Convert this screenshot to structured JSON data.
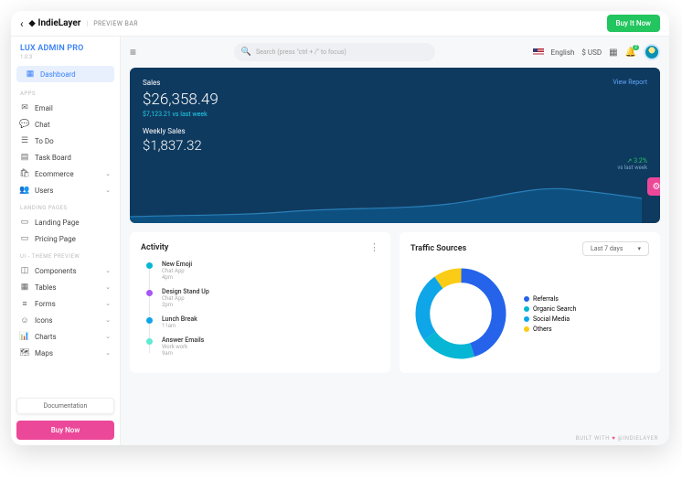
{
  "previewBar": {
    "brand": "IndieLayer",
    "label": "PREVIEW BAR",
    "cta": "Buy It Now"
  },
  "sidebar": {
    "title": "LUX ADMIN PRO",
    "version": "1.0.3",
    "active": "Dashboard",
    "sections": {
      "apps": "APPS",
      "landing": "LANDING PAGES",
      "theme": "UI - THEME PREVIEW"
    },
    "items": {
      "dashboard": "Dashboard",
      "email": "Email",
      "chat": "Chat",
      "todo": "To Do",
      "taskboard": "Task Board",
      "ecommerce": "Ecommerce",
      "users": "Users",
      "landing": "Landing Page",
      "pricing": "Pricing Page",
      "components": "Components",
      "tables": "Tables",
      "forms": "Forms",
      "icons": "Icons",
      "charts": "Charts",
      "maps": "Maps"
    },
    "docs": "Documentation",
    "buynow": "Buy Now"
  },
  "topbar": {
    "search": "Search (press \"ctrl + /\" to focus)",
    "lang": "English",
    "currency": "$ USD",
    "notifications": "2"
  },
  "hero": {
    "title": "Sales",
    "viewReport": "View Report",
    "amount": "$26,358.49",
    "compare": "$7,123.21 vs last week",
    "weeklyTitle": "Weekly Sales",
    "weeklyAmount": "$1,837.32",
    "trendPct": "↗ 3.2%",
    "trendLabel": "vs last week"
  },
  "activity": {
    "title": "Activity",
    "items": [
      {
        "title": "New Emoji",
        "sub": "Chat App",
        "time": "4pm",
        "color": "#06b6d4"
      },
      {
        "title": "Design Stand Up",
        "sub": "Chat App",
        "time": "2pm",
        "color": "#a855f7"
      },
      {
        "title": "Lunch Break",
        "sub": "",
        "time": "11am",
        "color": "#0ea5e9"
      },
      {
        "title": "Answer Emails",
        "sub": "Work work",
        "time": "9am",
        "color": "#5eead4"
      }
    ]
  },
  "traffic": {
    "title": "Traffic Sources",
    "range": "Last 7 days",
    "legend": [
      {
        "label": "Referrals",
        "color": "#2563eb"
      },
      {
        "label": "Organic Search",
        "color": "#06b6d4"
      },
      {
        "label": "Social Media",
        "color": "#0ea5e9"
      },
      {
        "label": "Others",
        "color": "#facc15"
      }
    ]
  },
  "footer": {
    "builtWith": "BUILT WITH",
    "by": "@INDIELAYER"
  },
  "chart_data": [
    {
      "type": "area",
      "title": "Sales sparkline",
      "x": [
        0,
        1,
        2,
        3,
        4,
        5,
        6,
        7,
        8,
        9,
        10
      ],
      "values": [
        6,
        7,
        6,
        8,
        9,
        8,
        10,
        14,
        22,
        20,
        18
      ],
      "ylim": [
        0,
        30
      ]
    },
    {
      "type": "pie",
      "title": "Traffic Sources",
      "series": [
        {
          "name": "Referrals",
          "value": 45,
          "color": "#2563eb"
        },
        {
          "name": "Organic Search",
          "value": 20,
          "color": "#06b6d4"
        },
        {
          "name": "Social Media",
          "value": 25,
          "color": "#0ea5e9"
        },
        {
          "name": "Others",
          "value": 10,
          "color": "#facc15"
        }
      ]
    }
  ]
}
